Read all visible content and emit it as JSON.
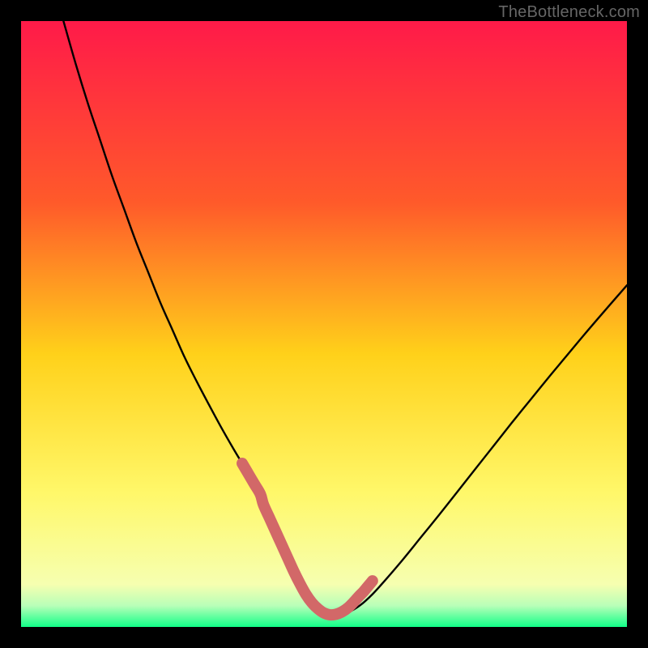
{
  "watermark": "TheBottleneck.com",
  "chart_data": {
    "type": "line",
    "title": "",
    "xlabel": "",
    "ylabel": "",
    "xlim": [
      0,
      100
    ],
    "ylim": [
      0,
      100
    ],
    "grid": false,
    "legend": false,
    "annotations": [],
    "gradient_stops": [
      {
        "offset": 0.0,
        "color": "#ff1a49"
      },
      {
        "offset": 0.3,
        "color": "#ff5a2a"
      },
      {
        "offset": 0.55,
        "color": "#ffd11a"
      },
      {
        "offset": 0.78,
        "color": "#fff86a"
      },
      {
        "offset": 0.93,
        "color": "#f6ffb0"
      },
      {
        "offset": 0.965,
        "color": "#b8ffb8"
      },
      {
        "offset": 1.0,
        "color": "#11ff88"
      }
    ],
    "series": [
      {
        "name": "curve",
        "color": "#000000",
        "x": [
          7,
          9,
          11,
          13,
          15,
          17,
          19,
          21,
          23,
          25,
          27,
          29,
          31,
          33,
          35,
          36.5,
          38,
          39,
          40,
          41,
          42,
          43,
          44,
          45,
          46,
          47,
          48,
          49,
          50,
          51,
          52.5,
          54,
          56,
          58,
          60,
          63,
          66,
          69,
          72,
          75,
          78,
          81,
          84,
          87,
          90,
          93,
          96,
          100
        ],
        "y": [
          100,
          93,
          86.5,
          80.5,
          74.5,
          69,
          63.5,
          58.5,
          53.5,
          49,
          44.5,
          40.5,
          36.7,
          33,
          29.5,
          27,
          24.6,
          22.4,
          20.2,
          18,
          15.8,
          13.6,
          11.4,
          9.2,
          7.2,
          5.4,
          4,
          3,
          2.3,
          2,
          2,
          2.4,
          3.6,
          5.4,
          7.6,
          11.1,
          14.8,
          18.5,
          22.3,
          26.1,
          29.9,
          33.7,
          37.4,
          41.1,
          44.7,
          48.3,
          51.8,
          56.4
        ]
      },
      {
        "name": "highlight",
        "color": "#d26868",
        "x": [
          36.5,
          37.5,
          38.5,
          39.5,
          40,
          41,
          42,
          43,
          44,
          45,
          46,
          47,
          48,
          49,
          50,
          51,
          52,
          53,
          54,
          55,
          55.8,
          56.5,
          57,
          57.5,
          58
        ],
        "y": [
          27,
          25.3,
          23.6,
          21.9,
          20.2,
          18,
          15.8,
          13.6,
          11.4,
          9.2,
          7.2,
          5.4,
          4,
          3,
          2.3,
          2,
          2.1,
          2.5,
          3.2,
          4.2,
          5.1,
          5.8,
          6.4,
          7,
          7.6
        ]
      }
    ]
  }
}
